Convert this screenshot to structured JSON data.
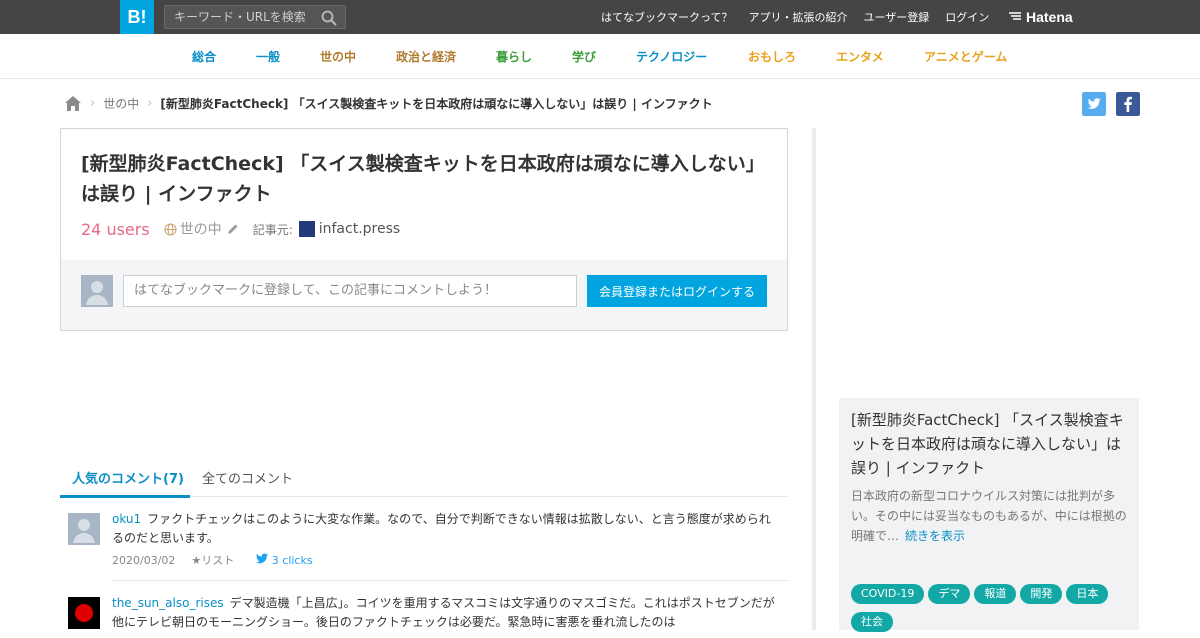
{
  "header": {
    "logo": "B!",
    "search_placeholder": "キーワード・URLを検索",
    "nav": [
      "はてなブックマークって？",
      "アプリ・拡張の紹介",
      "ユーザー登録",
      "ログイン"
    ],
    "brand": "Hatena"
  },
  "categories": [
    {
      "label": "総合",
      "color": "#0a8fc6"
    },
    {
      "label": "一般",
      "color": "#0a8fc6"
    },
    {
      "label": "世の中",
      "color": "#b07c2c"
    },
    {
      "label": "政治と経済",
      "color": "#b07c2c"
    },
    {
      "label": "暮らし",
      "color": "#3d9e3d"
    },
    {
      "label": "学び",
      "color": "#3d9e3d"
    },
    {
      "label": "テクノロジー",
      "color": "#0a8fc6"
    },
    {
      "label": "おもしろ",
      "color": "#e8a21c"
    },
    {
      "label": "エンタメ",
      "color": "#e8a21c"
    },
    {
      "label": "アニメとゲーム",
      "color": "#e8a21c"
    }
  ],
  "breadcrumb": {
    "category": "世の中",
    "current": "[新型肺炎FactCheck] 「スイス製検査キットを日本政府は頑なに導入しない」は誤り | インファクト"
  },
  "entry": {
    "title": "[新型肺炎FactCheck] 「スイス製検査キットを日本政府は頑なに導入しない」は誤り | インファクト",
    "users": "24 users",
    "category": "世の中",
    "source_label": "記事元:",
    "source": "infact.press",
    "comment_placeholder": "はてなブックマークに登録して、この記事にコメントしよう！",
    "login_button": "会員登録またはログインする"
  },
  "tabs": {
    "popular": "人気のコメント(7)",
    "all": "全てのコメント"
  },
  "comments": [
    {
      "user": "oku1",
      "text": "ファクトチェックはこのように大変な作業。なので、自分で判断できない情報は拡散しない、と言う態度が求められるのだと思います。",
      "date": "2020/03/02",
      "list": "リスト",
      "clicks": "3 clicks"
    },
    {
      "user": "the_sun_also_rises",
      "text": "デマ製造機「上昌広」。コイツを重用するマスコミは文字通りのマスゴミだ。これはポストセブンだが他にテレビ朝日のモーニングショー。後日のファクトチェックは必要だ。緊急時に害悪を垂れ流したのは"
    }
  ],
  "side": {
    "title": "[新型肺炎FactCheck] 「スイス製検査キットを日本政府は頑なに導入しない」は誤り | インファクト",
    "description": "日本政府の新型コロナウイルス対策には批判が多い。その中には妥当なものもあるが、中には根拠の明確で…",
    "more": "続きを表示",
    "tags": [
      "COVID-19",
      "デマ",
      "報道",
      "開発",
      "日本",
      "社会"
    ]
  }
}
